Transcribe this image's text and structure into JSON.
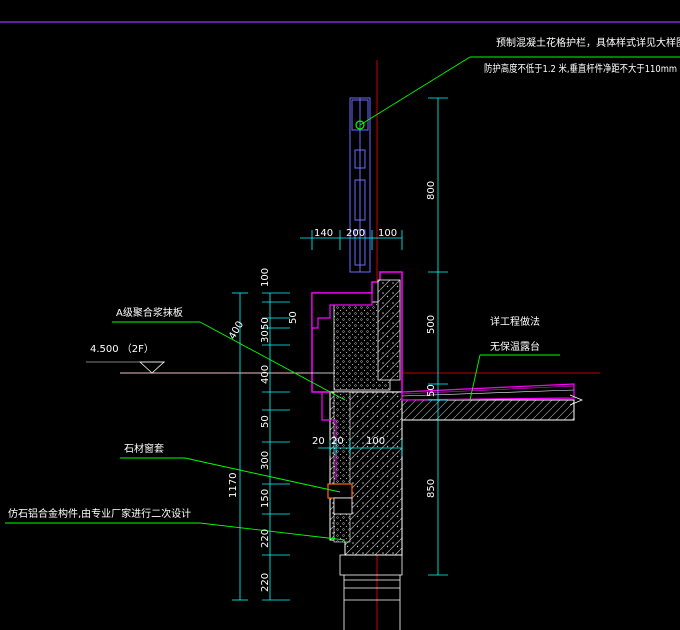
{
  "notes": {
    "baluster_line1": "预制混凝土花格护栏，具体样式详见大样图(参",
    "baluster_line2": "防护高度不低于1.2 米,垂直杆件净距不大于110mm",
    "plaster": "A级聚合浆抹板",
    "elevation": "4.500 （2F）",
    "stone_sill": "石材窗套",
    "aluminum": "仿石铝合金构件,由专业厂家进行二次设计",
    "engineering": "详工程做法",
    "waterproof": "无保温露台"
  },
  "dims": {
    "top_140": "140",
    "top_200": "200",
    "top_100": "100",
    "left_100": "100",
    "left_400_rot": "400",
    "left_50a": "50",
    "left_50b": "50",
    "left_30": "30",
    "left_400": "400",
    "left_50c": "50",
    "left_300": "300",
    "left_150": "150",
    "left_220a": "220",
    "left_220b": "220",
    "total_1170": "1170",
    "bottom_20a": "20",
    "bottom_20b": "20",
    "bottom_100": "100",
    "right_800": "800",
    "right_500": "500",
    "right_50": "50",
    "right_850": "850"
  },
  "colors": {
    "background": "#000000",
    "dimension_line": "#00ffff",
    "leader_line": "#00ff00",
    "section_outline": "#ff00ff",
    "structure": "#ffffff",
    "axis_line": "#ff0000",
    "border_line": "#9b30ff"
  }
}
